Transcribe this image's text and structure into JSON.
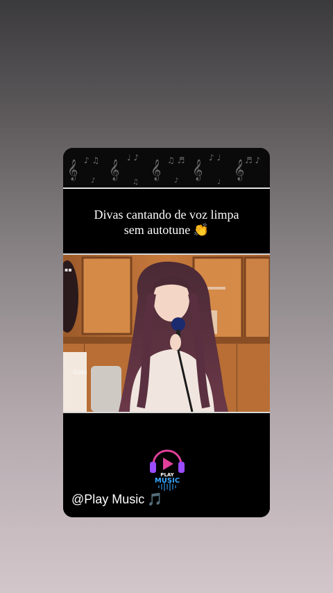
{
  "caption": {
    "line1": "Divas cantando de voz limpa",
    "line2": "sem autotune 👏"
  },
  "video": {
    "thumbnail_desc_icon": "singer-icon"
  },
  "logo": {
    "line1": "PLAY",
    "line2": "MUSIC"
  },
  "handle": {
    "text": "@Play Music",
    "note": "🎵"
  },
  "colors": {
    "logo_pink": "#e0409a",
    "logo_blue": "#3aa8ff",
    "logo_purple": "#9a4cff"
  }
}
